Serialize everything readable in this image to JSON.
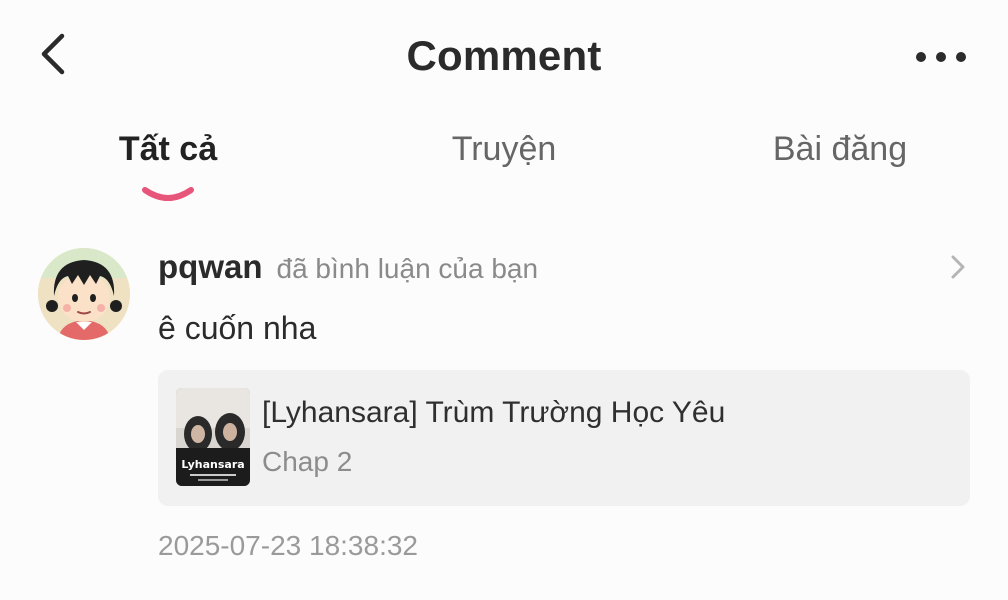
{
  "header": {
    "title": "Comment",
    "back_icon": "chevron-left-icon",
    "more_icon": "more-horizontal-icon"
  },
  "tabs": [
    {
      "label": "Tất cả",
      "active": true
    },
    {
      "label": "Truyện",
      "active": false
    },
    {
      "label": "Bài đăng",
      "active": false
    }
  ],
  "accent_color": "#e8557a",
  "notification": {
    "username": "pqwan",
    "action": "đã bình luận của bạn",
    "comment": "ê cuốn nha",
    "story": {
      "title": "[Lyhansara] Trùm Trường Học Yêu",
      "chapter": "Chap 2",
      "cover_text": "Lyhansara"
    },
    "timestamp": "2025-07-23 18:38:32"
  }
}
